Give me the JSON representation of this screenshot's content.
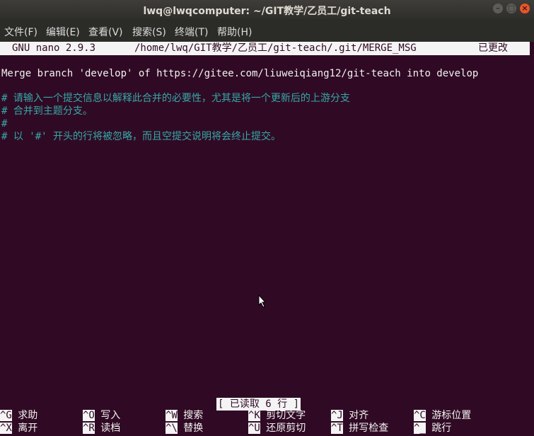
{
  "window": {
    "title": "lwq@lwqcomputer: ~/GIT教学/乙员工/git-teach"
  },
  "menu": [
    "文件(F)",
    "编辑(E)",
    "查看(V)",
    "搜索(S)",
    "终端(T)",
    "帮助(H)"
  ],
  "nano": {
    "version": "GNU nano 2.9.3",
    "file": "/home/lwq/GIT教学/乙员工/git-teach/.git/MERGE_MSG",
    "state": "已更改"
  },
  "content": {
    "merge_line": "Merge branch 'develop' of https://gitee.com/liuweiqiang12/git-teach into develop",
    "comments": [
      "# 请输入一个提交信息以解释此合并的必要性，尤其是将一个更新后的上游分支",
      "# 合并到主题分支。",
      "#",
      "# 以 '#' 开头的行将被忽略，而且空提交说明将会终止提交。"
    ]
  },
  "status": "[ 已读取 6 行 ]",
  "shortcuts": [
    {
      "key": "^G",
      "label": "求助"
    },
    {
      "key": "^O",
      "label": "写入"
    },
    {
      "key": "^W",
      "label": "搜索"
    },
    {
      "key": "^K",
      "label": "剪切文字"
    },
    {
      "key": "^J",
      "label": "对齐"
    },
    {
      "key": "^C",
      "label": "游标位置"
    },
    {
      "key": "^X",
      "label": "离开"
    },
    {
      "key": "^R",
      "label": "读档"
    },
    {
      "key": "^\\",
      "label": "替换"
    },
    {
      "key": "^U",
      "label": "还原剪切"
    },
    {
      "key": "^T",
      "label": "拼写检查"
    },
    {
      "key": "^_",
      "label": "跳行"
    }
  ]
}
